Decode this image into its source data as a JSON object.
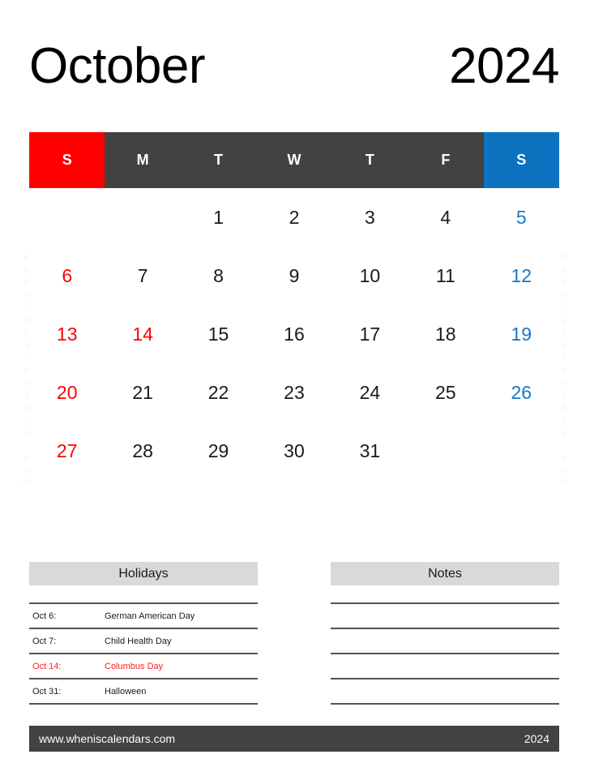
{
  "title": {
    "month": "October",
    "year": "2024"
  },
  "watermark": {
    "text": "wheniscalendars.com"
  },
  "calendar": {
    "day_headers": [
      "S",
      "M",
      "T",
      "W",
      "T",
      "F",
      "S"
    ],
    "weeks": [
      [
        {
          "label": "",
          "kind": "empty"
        },
        {
          "label": "",
          "kind": "empty"
        },
        {
          "label": "1",
          "kind": "weekday"
        },
        {
          "label": "2",
          "kind": "weekday"
        },
        {
          "label": "3",
          "kind": "weekday"
        },
        {
          "label": "4",
          "kind": "weekday"
        },
        {
          "label": "5",
          "kind": "sat"
        }
      ],
      [
        {
          "label": "6",
          "kind": "sun"
        },
        {
          "label": "7",
          "kind": "weekday"
        },
        {
          "label": "8",
          "kind": "weekday"
        },
        {
          "label": "9",
          "kind": "weekday"
        },
        {
          "label": "10",
          "kind": "weekday"
        },
        {
          "label": "11",
          "kind": "weekday"
        },
        {
          "label": "12",
          "kind": "sat"
        }
      ],
      [
        {
          "label": "13",
          "kind": "sun"
        },
        {
          "label": "14",
          "kind": "holiday"
        },
        {
          "label": "15",
          "kind": "weekday"
        },
        {
          "label": "16",
          "kind": "weekday"
        },
        {
          "label": "17",
          "kind": "weekday"
        },
        {
          "label": "18",
          "kind": "weekday"
        },
        {
          "label": "19",
          "kind": "sat"
        }
      ],
      [
        {
          "label": "20",
          "kind": "sun"
        },
        {
          "label": "21",
          "kind": "weekday"
        },
        {
          "label": "22",
          "kind": "weekday"
        },
        {
          "label": "23",
          "kind": "weekday"
        },
        {
          "label": "24",
          "kind": "weekday"
        },
        {
          "label": "25",
          "kind": "weekday"
        },
        {
          "label": "26",
          "kind": "sat"
        }
      ],
      [
        {
          "label": "27",
          "kind": "sun"
        },
        {
          "label": "28",
          "kind": "weekday"
        },
        {
          "label": "29",
          "kind": "weekday"
        },
        {
          "label": "30",
          "kind": "weekday"
        },
        {
          "label": "31",
          "kind": "weekday"
        },
        {
          "label": "",
          "kind": "empty"
        },
        {
          "label": "",
          "kind": "empty"
        }
      ]
    ]
  },
  "holidays": {
    "heading": "Holidays",
    "items": [
      {
        "date": "Oct 6:",
        "name": "German American Day",
        "highlight": false
      },
      {
        "date": "Oct 7:",
        "name": "Child Health Day",
        "highlight": false
      },
      {
        "date": "Oct 14:",
        "name": "Columbus Day",
        "highlight": true
      },
      {
        "date": "Oct 31:",
        "name": "Halloween",
        "highlight": false
      }
    ]
  },
  "notes": {
    "heading": "Notes",
    "lines": [
      "",
      "",
      "",
      "",
      ""
    ]
  },
  "footer": {
    "website": "www.wheniscalendars.com",
    "year": "2024"
  },
  "colors": {
    "sunday_header": "#ff0000",
    "saturday_header": "#0d72c0",
    "weekday_header": "#424242",
    "panel_header": "#d9d9d9",
    "footer_bar": "#424242",
    "holiday_text": "#ff2020",
    "saturday_text": "#1578cd"
  }
}
